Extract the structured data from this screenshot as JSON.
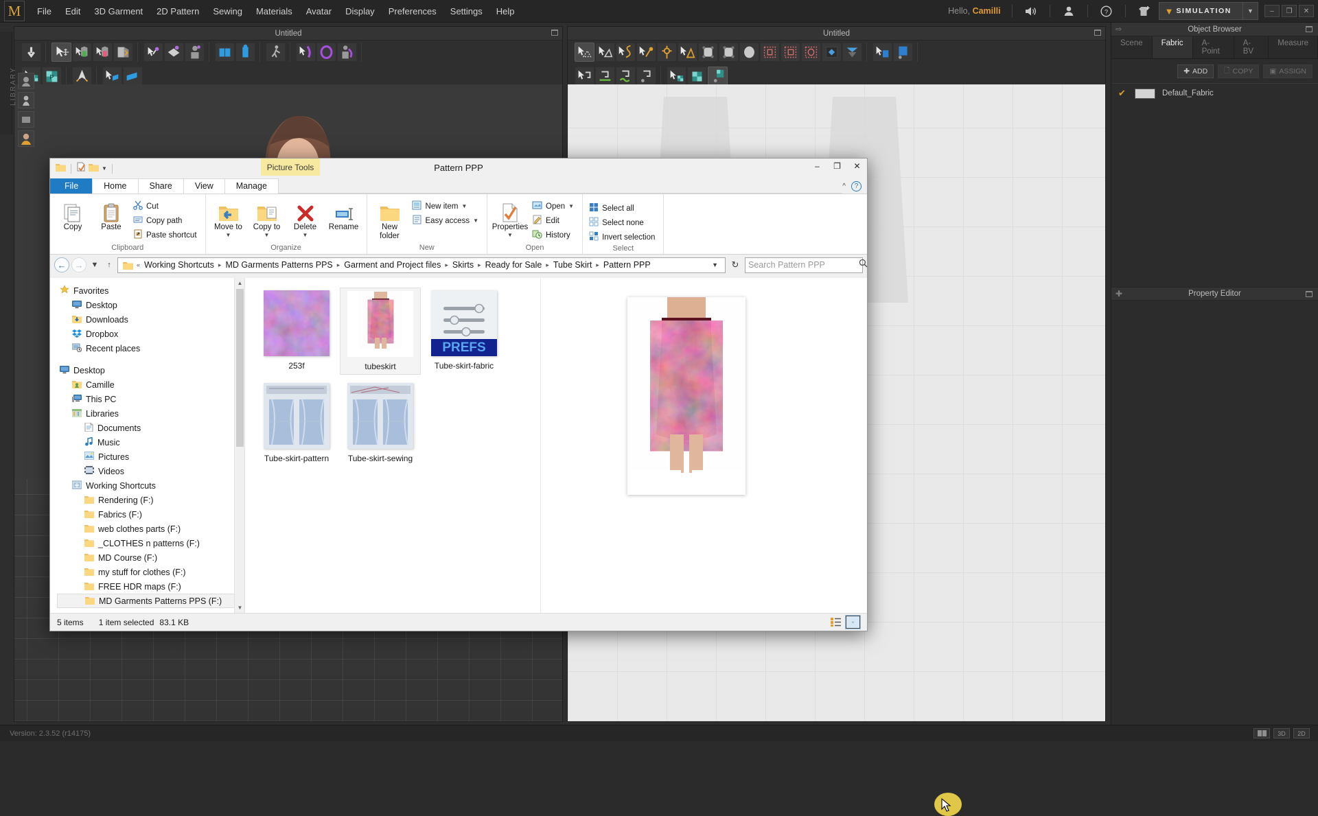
{
  "app": {
    "logo": "M",
    "menu": [
      "File",
      "Edit",
      "3D Garment",
      "2D Pattern",
      "Sewing",
      "Materials",
      "Avatar",
      "Display",
      "Preferences",
      "Settings",
      "Help"
    ],
    "greeting_prefix": "Hello,",
    "user": "Camilli",
    "simulation_label": "SIMULATION",
    "version": "Version: 2.3.52    (r14175)",
    "library_tab": "LIBRARY",
    "window_buttons": {
      "minimize": "–",
      "maximize": "❐",
      "close": "✕"
    },
    "status_view_buttons": [
      "⬛⬛",
      "3D",
      "2D"
    ]
  },
  "viewports": {
    "left_title": "Untitled",
    "right_title": "Untitled"
  },
  "dock": {
    "object_browser_title": "Object Browser",
    "tabs": [
      {
        "label": "Scene",
        "active": false
      },
      {
        "label": "Fabric",
        "active": true
      },
      {
        "label": "A-Point",
        "active": false
      },
      {
        "label": "A-BV",
        "active": false
      },
      {
        "label": "Measure",
        "active": false
      }
    ],
    "actions": [
      {
        "label": "ADD",
        "icon": "plus-icon",
        "enabled": true
      },
      {
        "label": "COPY",
        "icon": "copy-icon",
        "enabled": false
      },
      {
        "label": "ASSIGN",
        "icon": "assign-icon",
        "enabled": false
      }
    ],
    "fabrics": [
      {
        "name": "Default_Fabric",
        "checked": true,
        "swatch": "#d4d4d4"
      }
    ],
    "property_editor_title": "Property Editor"
  },
  "explorer": {
    "title": "Pattern PPP",
    "contextual_tools": "Picture Tools",
    "window_buttons": {
      "minimize": "–",
      "maximize": "❐",
      "close": "✕"
    },
    "tabs": [
      {
        "label": "File",
        "kind": "file"
      },
      {
        "label": "Home",
        "kind": "home"
      },
      {
        "label": "Share",
        "kind": "normal"
      },
      {
        "label": "View",
        "kind": "normal"
      },
      {
        "label": "Manage",
        "kind": "normal"
      }
    ],
    "ribbon": {
      "groups": [
        {
          "label": "Clipboard",
          "big": [
            {
              "label": "Copy",
              "icon": "copy-icon"
            },
            {
              "label": "Paste",
              "icon": "paste-icon"
            }
          ],
          "small": [
            {
              "label": "Cut",
              "icon": "scissors-icon"
            },
            {
              "label": "Copy path",
              "icon": "copy-path-icon"
            },
            {
              "label": "Paste shortcut",
              "icon": "paste-shortcut-icon"
            }
          ]
        },
        {
          "label": "Organize",
          "big": [
            {
              "label": "Move to",
              "icon": "move-to-icon",
              "caret": true
            },
            {
              "label": "Copy to",
              "icon": "copy-to-icon",
              "caret": true
            },
            {
              "label": "Delete",
              "icon": "delete-icon",
              "caret": true
            },
            {
              "label": "Rename",
              "icon": "rename-icon"
            }
          ],
          "small": []
        },
        {
          "label": "New",
          "big": [
            {
              "label": "New folder",
              "icon": "new-folder-icon"
            }
          ],
          "small": [
            {
              "label": "New item",
              "icon": "new-item-icon",
              "caret": true
            },
            {
              "label": "Easy access",
              "icon": "easy-access-icon",
              "caret": true
            }
          ]
        },
        {
          "label": "Open",
          "big": [
            {
              "label": "Properties",
              "icon": "properties-icon",
              "caret": true
            }
          ],
          "small": [
            {
              "label": "Open",
              "icon": "open-icon",
              "caret": true
            },
            {
              "label": "Edit",
              "icon": "edit-icon"
            },
            {
              "label": "History",
              "icon": "history-icon"
            }
          ]
        },
        {
          "label": "Select",
          "big": [],
          "small": [
            {
              "label": "Select all",
              "icon": "select-all-icon"
            },
            {
              "label": "Select none",
              "icon": "select-none-icon"
            },
            {
              "label": "Invert selection",
              "icon": "invert-selection-icon"
            }
          ]
        }
      ]
    },
    "breadcrumbs": [
      "Working Shortcuts",
      "MD Garments Patterns PPS",
      "Garment and Project files",
      "Skirts",
      "Ready for Sale",
      "Tube Skirt",
      "Pattern PPP"
    ],
    "search_placeholder": "Search Pattern PPP",
    "search_value": "",
    "nav_sections": [
      {
        "root": {
          "label": "Favorites",
          "icon": "star-icon",
          "indent": 0
        },
        "items": [
          {
            "label": "Desktop",
            "icon": "desktop-icon",
            "indent": 1
          },
          {
            "label": "Downloads",
            "icon": "downloads-icon",
            "indent": 1
          },
          {
            "label": "Dropbox",
            "icon": "dropbox-icon",
            "indent": 1
          },
          {
            "label": "Recent places",
            "icon": "recent-places-icon",
            "indent": 1
          }
        ]
      },
      {
        "root": {
          "label": "Desktop",
          "icon": "desktop-icon",
          "indent": 0
        },
        "items": [
          {
            "label": "Camille",
            "icon": "user-folder-icon",
            "indent": 1
          },
          {
            "label": "This PC",
            "icon": "this-pc-icon",
            "indent": 1
          },
          {
            "label": "Libraries",
            "icon": "libraries-icon",
            "indent": 1
          },
          {
            "label": "Documents",
            "icon": "document-icon",
            "indent": 2
          },
          {
            "label": "Music",
            "icon": "music-icon",
            "indent": 2
          },
          {
            "label": "Pictures",
            "icon": "pictures-icon",
            "indent": 2
          },
          {
            "label": "Videos",
            "icon": "videos-icon",
            "indent": 2
          },
          {
            "label": "Working Shortcuts",
            "icon": "shortcuts-icon",
            "indent": 1
          },
          {
            "label": "Rendering (F:)",
            "icon": "folder-icon",
            "indent": 2
          },
          {
            "label": "Fabrics (F:)",
            "icon": "folder-icon",
            "indent": 2
          },
          {
            "label": "web clothes parts (F:)",
            "icon": "folder-icon",
            "indent": 2
          },
          {
            "label": "_CLOTHES n patterns (F:)",
            "icon": "folder-icon",
            "indent": 2
          },
          {
            "label": "MD Course (F:)",
            "icon": "folder-icon",
            "indent": 2
          },
          {
            "label": "my stuff for clothes (F:)",
            "icon": "folder-icon",
            "indent": 2
          },
          {
            "label": "FREE HDR maps (F:)",
            "icon": "folder-icon",
            "indent": 2
          },
          {
            "label": "MD Garments Patterns PPS (F:)",
            "icon": "folder-icon",
            "indent": 2,
            "selected": true
          }
        ]
      }
    ],
    "files": [
      {
        "name": "253f",
        "thumb": "fabric-purple",
        "selected": false
      },
      {
        "name": "tubeskirt",
        "thumb": "skirt-render",
        "selected": true
      },
      {
        "name": "Tube-skirt-fabric",
        "thumb": "prefs-sliders",
        "selected": false,
        "badge": "PREFS"
      },
      {
        "name": "Tube-skirt-pattern",
        "thumb": "pattern-blue",
        "selected": false
      },
      {
        "name": "Tube-skirt-sewing",
        "thumb": "pattern-blue",
        "selected": false
      }
    ],
    "status": {
      "item_count": "5 items",
      "selection": "1 item selected",
      "size": "83.1 KB"
    },
    "view_buttons": [
      {
        "name": "details-view",
        "active": false
      },
      {
        "name": "large-icons-view",
        "active": true
      }
    ]
  },
  "colors": {
    "accent_orange": "#e09b2d",
    "explorer_blue": "#1f7bc4",
    "prefs_blue": "#1b2f8f",
    "highlight_yellow": "#f7eaa0",
    "cursor_yellow": "#f5d84b"
  }
}
